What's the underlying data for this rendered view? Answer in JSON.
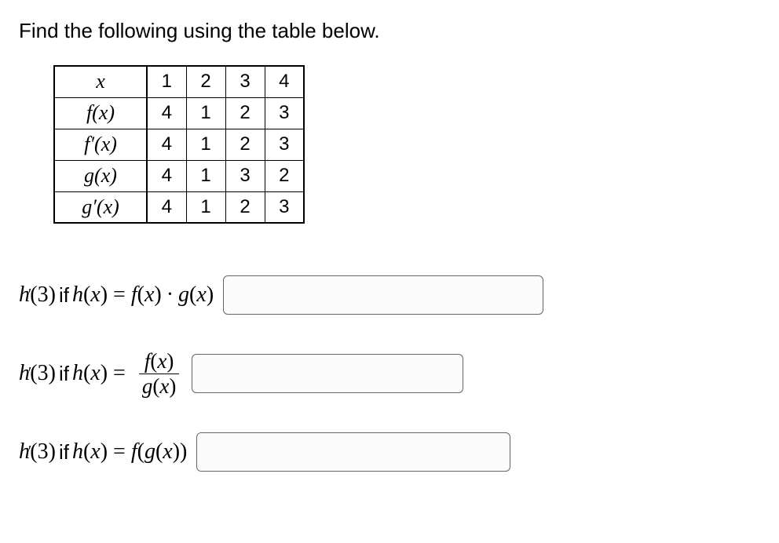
{
  "prompt": "Find the following using the table below.",
  "table": {
    "header_label": "x",
    "columns": [
      "1",
      "2",
      "3",
      "4"
    ],
    "rows": [
      {
        "label": "f(x)",
        "values": [
          "4",
          "1",
          "2",
          "3"
        ]
      },
      {
        "label": "f′(x)",
        "values": [
          "4",
          "1",
          "2",
          "3"
        ]
      },
      {
        "label": "g(x)",
        "values": [
          "4",
          "1",
          "3",
          "2"
        ]
      },
      {
        "label": "g′(x)",
        "values": [
          "4",
          "1",
          "2",
          "3"
        ]
      }
    ]
  },
  "questions": {
    "q1": {
      "lhs": "h′(3)",
      "if": "if",
      "mid": "h(x) =",
      "rhs": "f(x) · g(x)",
      "answer": ""
    },
    "q2": {
      "lhs": "h′(3)",
      "if": "if",
      "mid": "h(x) =",
      "frac_num": "f(x)",
      "frac_den": "g(x)",
      "answer": ""
    },
    "q3": {
      "lhs": "h′(3)",
      "if": "if",
      "mid": "h(x) =",
      "rhs": "f(g(x))",
      "answer": ""
    }
  },
  "chart_data": {
    "type": "table",
    "title": "Function value table",
    "columns": [
      "x",
      "f(x)",
      "f'(x)",
      "g(x)",
      "g'(x)"
    ],
    "rows": [
      {
        "x": 1,
        "f(x)": 4,
        "f'(x)": 4,
        "g(x)": 4,
        "g'(x)": 4
      },
      {
        "x": 2,
        "f(x)": 1,
        "f'(x)": 1,
        "g(x)": 1,
        "g'(x)": 1
      },
      {
        "x": 3,
        "f(x)": 2,
        "f'(x)": 2,
        "g(x)": 3,
        "g'(x)": 2
      },
      {
        "x": 4,
        "f(x)": 3,
        "f'(x)": 3,
        "g(x)": 2,
        "g'(x)": 3
      }
    ]
  }
}
